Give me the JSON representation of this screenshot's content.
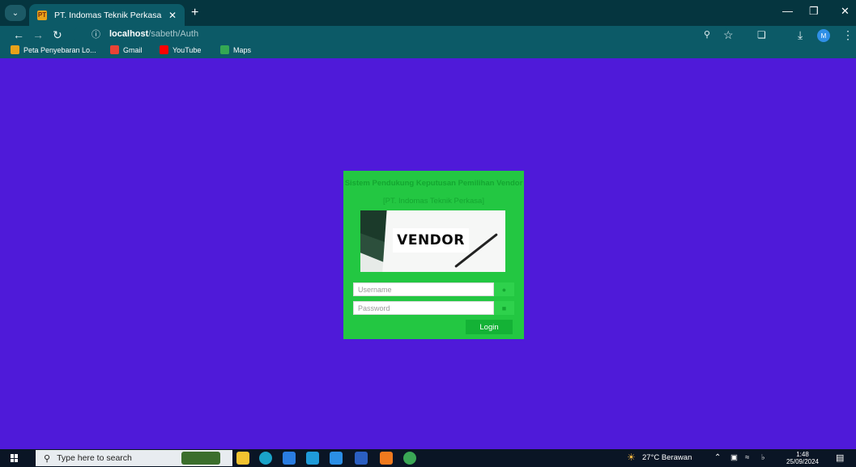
{
  "browser": {
    "tab_title": "PT. Indomas Teknik Perkasa",
    "tab_favicon_label": "PT",
    "url_host": "localhost",
    "url_path": "/sabeth/Auth",
    "profile_initial": "M",
    "bookmarks": [
      {
        "label": "Peta Penyebaran Lo...",
        "icon": "map-pin-icon",
        "color": "#e8a21a"
      },
      {
        "label": "Gmail",
        "icon": "gmail-icon",
        "color": "#ea4335"
      },
      {
        "label": "YouTube",
        "icon": "youtube-icon",
        "color": "#ff0000"
      },
      {
        "label": "Maps",
        "icon": "maps-icon",
        "color": "#34a853"
      }
    ]
  },
  "login": {
    "title": "Sistem Pendukung Keputusan Pemilihan Vendor",
    "subtitle": "[PT. Indomas Teknik Perkasa]",
    "banner_text": "VENDOR",
    "username_placeholder": "Username",
    "password_placeholder": "Password",
    "login_label": "Login",
    "colors": {
      "page_bg": "#4f1ad9",
      "card_bg": "#23c742",
      "button_bg": "#14b236"
    }
  },
  "taskbar": {
    "search_placeholder": "Type here to search",
    "weather": "27°C Berawan",
    "time": "1:48",
    "date": "25/09/2024",
    "pinned_apps": [
      "file-explorer-icon",
      "edge-icon",
      "store-icon",
      "mail-icon",
      "vscode-icon",
      "word-icon",
      "xampp-icon",
      "chrome-icon"
    ]
  }
}
